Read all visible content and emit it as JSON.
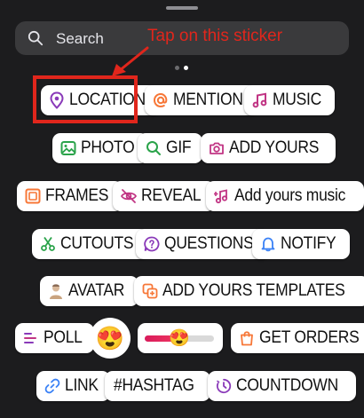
{
  "search": {
    "placeholder": "Search"
  },
  "annotation": {
    "text": "Tap on this sticker",
    "color": "#e0261c"
  },
  "pager": {
    "pages": 2,
    "current": 2
  },
  "stickers": {
    "location": "LOCATION",
    "mention": "MENTION",
    "music": "MUSIC",
    "photo": "PHOTO",
    "gif": "GIF",
    "add_yours": "ADD YOURS",
    "frames": "FRAMES",
    "reveal": "REVEAL",
    "add_yours_music": "Add yours music",
    "cutouts": "CUTOUTS",
    "questions": "QUESTIONS",
    "notify": "NOTIFY",
    "avatar": "AVATAR",
    "add_yours_templates": "ADD YOURS TEMPLATES",
    "poll": "POLL",
    "get_orders": "GET ORDERS",
    "link": "LINK",
    "hashtag": "#HASHTAG",
    "countdown": "COUNTDOWN"
  },
  "emoji_sticker": {
    "emoji": "😍"
  },
  "slider_sticker": {
    "emoji": "😍",
    "level": 0.5
  },
  "colors": {
    "background": "#1c1c1e",
    "search_bg": "#3a3a3c",
    "location": "#8a3ab9",
    "mention": "#f77737",
    "music": "#c13584",
    "photo": "#2aa34a",
    "gif": "#2aa34a",
    "add_yours": "#c13584",
    "frames": "#f77737",
    "reveal": "#c13584",
    "cutouts": "#2aa34a",
    "questions": "#8a3ab9",
    "notify": "#3b82f6",
    "poll": "#8a3ab9",
    "get_orders": "#f77737",
    "link": "#3b82f6",
    "hashtag": "#8a3ab9",
    "countdown": "#8a3ab9"
  }
}
